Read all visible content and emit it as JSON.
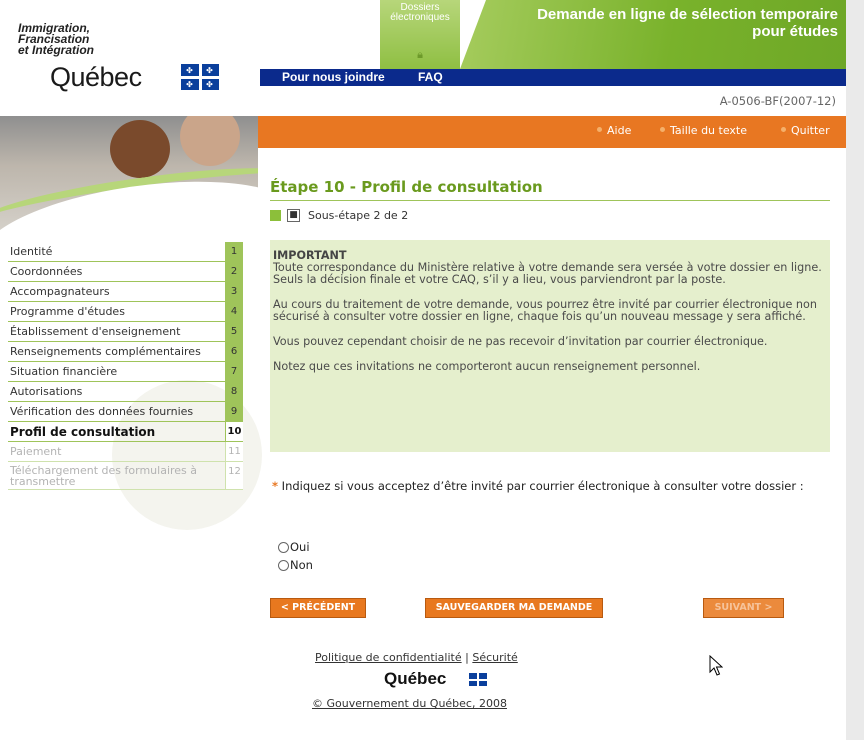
{
  "header": {
    "ministry_line1": "Immigration,",
    "ministry_line2": "Francisation",
    "ministry_line3": "et Intégration",
    "quebec_logo": "Québec",
    "dossiers_label_1": "Dossiers",
    "dossiers_label_2": "électroniques",
    "title_line1": "Demande en ligne de sélection temporaire",
    "title_line2": "pour études",
    "nav": [
      "Pour nous joindre",
      "FAQ"
    ],
    "form_code": "A-0506-BF(2007-12)"
  },
  "utility_links": [
    "Aide",
    "Taille du texte",
    "Quitter"
  ],
  "sidebar": {
    "items": [
      {
        "label": "Identité",
        "num": "1"
      },
      {
        "label": "Coordonnées",
        "num": "2"
      },
      {
        "label": "Accompagnateurs",
        "num": "3"
      },
      {
        "label": "Programme d'études",
        "num": "4"
      },
      {
        "label": "Établissement d'enseignement",
        "num": "5"
      },
      {
        "label": "Renseignements complémentaires",
        "num": "6"
      },
      {
        "label": "Situation financière",
        "num": "7"
      },
      {
        "label": "Autorisations",
        "num": "8"
      },
      {
        "label": "Vérification des données fournies",
        "num": "9"
      },
      {
        "label": "Profil de consultation",
        "num": "10"
      },
      {
        "label": "Paiement",
        "num": "11"
      },
      {
        "label": "Téléchargement des formulaires à transmettre",
        "num": "12"
      }
    ]
  },
  "main": {
    "step_title": "Étape 10 - Profil de consultation",
    "substep_label": "Sous-étape 2 de 2",
    "info": {
      "heading": "IMPORTANT",
      "p1": "Toute correspondance du Ministère relative à votre demande sera versée à votre dossier en ligne.",
      "p1b": "Seuls la décision finale et votre CAQ, s’il y a lieu, vous parviendront par la poste.",
      "p2": "Au cours du traitement de votre demande, vous pourrez être invité par courrier électronique non sécurisé à consulter votre dossier en ligne, chaque fois qu’un nouveau message y sera affiché.",
      "p3": "Vous pouvez cependant choisir de ne pas recevoir d’invitation par courrier électronique.",
      "p4": "Notez que ces invitations ne comporteront aucun renseignement personnel."
    },
    "question_asterisk": "*",
    "question": "Indiquez si vous acceptez d’être invité par courrier électronique à consulter votre dossier :",
    "options": [
      "Oui",
      "Non"
    ],
    "buttons": {
      "previous": "< PRÉCÉDENT",
      "save": "SAUVEGARDER MA DEMANDE",
      "next": "SUIVANT >"
    }
  },
  "footer": {
    "privacy": "Politique de confidentialité",
    "separator": "|",
    "security": "Sécurité",
    "logo": "Québec",
    "copyright": "© Gouvernement du Québec, 2008"
  },
  "colors": {
    "green": "#8cbf3a",
    "orange": "#e87722",
    "navy": "#0b2a8c",
    "info_bg": "#e5efcd"
  }
}
